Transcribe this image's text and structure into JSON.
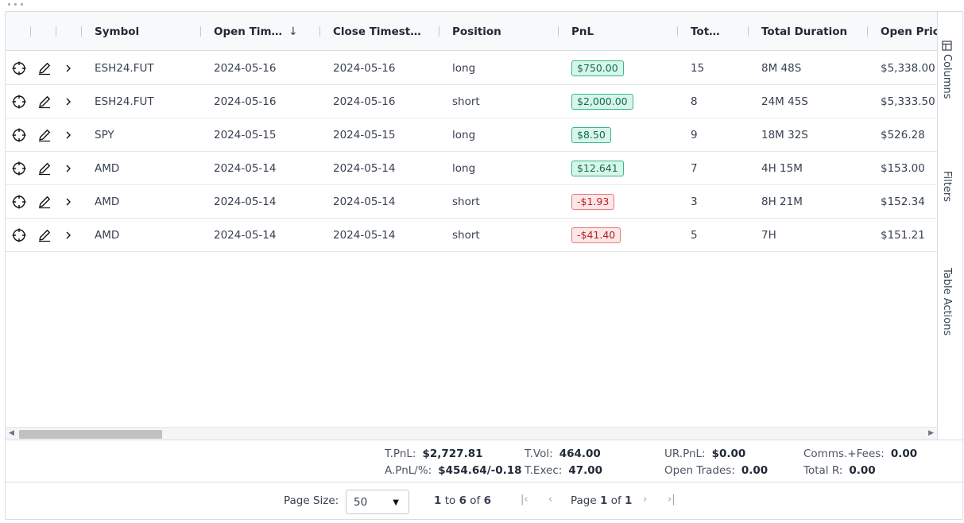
{
  "header": {
    "columns": [
      {
        "label": "Symbol"
      },
      {
        "label": "Open Tim…"
      },
      {
        "label": "Close Timest…"
      },
      {
        "label": "Position"
      },
      {
        "label": "PnL"
      },
      {
        "label": "Tot…"
      },
      {
        "label": "Total Duration"
      },
      {
        "label": "Open Price"
      }
    ],
    "sort_icon": "arrow-down-icon"
  },
  "rows": [
    {
      "symbol": "ESH24.FUT",
      "open": "2024-05-16",
      "close": "2024-05-16",
      "position": "long",
      "pnl": "$750.00",
      "pnl_sign": "pos",
      "tot": "15",
      "duration": "8M 48S",
      "open_price": "$5,338.00"
    },
    {
      "symbol": "ESH24.FUT",
      "open": "2024-05-16",
      "close": "2024-05-16",
      "position": "short",
      "pnl": "$2,000.00",
      "pnl_sign": "pos",
      "tot": "8",
      "duration": "24M 45S",
      "open_price": "$5,333.50"
    },
    {
      "symbol": "SPY",
      "open": "2024-05-15",
      "close": "2024-05-15",
      "position": "long",
      "pnl": "$8.50",
      "pnl_sign": "pos",
      "tot": "9",
      "duration": "18M 32S",
      "open_price": "$526.28"
    },
    {
      "symbol": "AMD",
      "open": "2024-05-14",
      "close": "2024-05-14",
      "position": "long",
      "pnl": "$12.641",
      "pnl_sign": "pos",
      "tot": "7",
      "duration": "4H 15M",
      "open_price": "$153.00"
    },
    {
      "symbol": "AMD",
      "open": "2024-05-14",
      "close": "2024-05-14",
      "position": "short",
      "pnl": "-$1.93",
      "pnl_sign": "neg",
      "tot": "3",
      "duration": "8H 21M",
      "open_price": "$152.34"
    },
    {
      "symbol": "AMD",
      "open": "2024-05-14",
      "close": "2024-05-14",
      "position": "short",
      "pnl": "-$41.40",
      "pnl_sign": "neg",
      "tot": "5",
      "duration": "7H",
      "open_price": "$151.21"
    }
  ],
  "row_icons": [
    "crosshair-icon",
    "pencil-icon",
    "chevron-right-icon"
  ],
  "side_panel": {
    "columns": "Columns",
    "filters": "Filters",
    "actions": "Table Actions"
  },
  "stats": {
    "t_pnl_label": "T.PnL:",
    "t_pnl": "$2,727.81",
    "a_pnl_label": "A.PnL/%:",
    "a_pnl": "$454.64/-0.18",
    "t_vol_label": "T.Vol:",
    "t_vol": "464.00",
    "t_exec_label": "T.Exec:",
    "t_exec": "47.00",
    "ur_pnl_label": "UR.PnL:",
    "ur_pnl": "$0.00",
    "open_trades_label": "Open Trades:",
    "open_trades": "0.00",
    "comms_label": "Comms.+Fees:",
    "comms": "0.00",
    "total_r_label": "Total R:",
    "total_r": "0.00"
  },
  "pagination": {
    "page_size_label": "Page Size:",
    "page_size": "50",
    "range_from": "1",
    "range_to_label": "to",
    "range_to": "6",
    "of_label": "of",
    "total": "6",
    "page_label": "Page",
    "page": "1",
    "page_of_label": "of",
    "page_total": "1"
  },
  "colors": {
    "pos_bg": "#d9f5ea",
    "pos_border": "#2dbb86",
    "neg_bg": "#fde6e6",
    "neg_border": "#ea7b7b"
  }
}
